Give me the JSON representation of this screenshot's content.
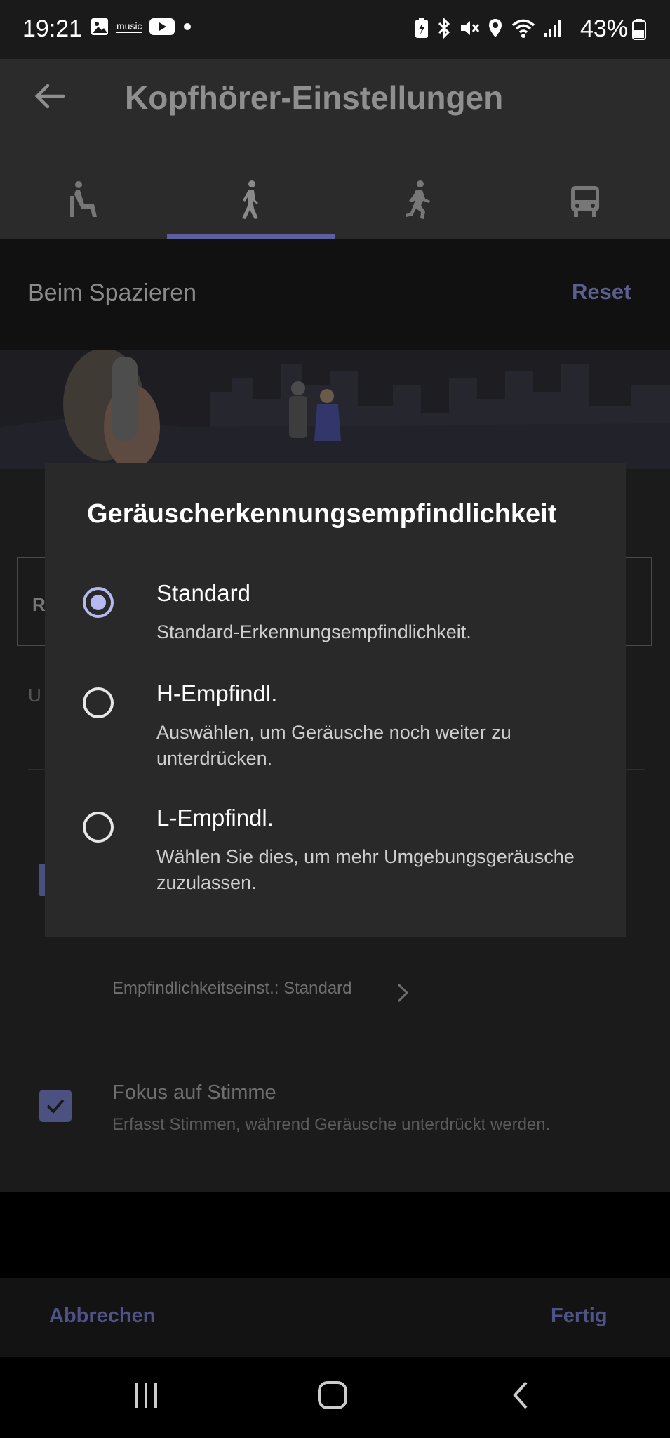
{
  "status_bar": {
    "time": "19:21",
    "app_icons": [
      "gallery-icon",
      "amazon-music-icon",
      "youtube-icon",
      "dot-icon"
    ],
    "system_icons": [
      "battery-saver-icon",
      "bluetooth-icon",
      "mute-icon",
      "location-icon",
      "wifi-icon",
      "signal-icon"
    ],
    "music_label": "music",
    "battery": "43%"
  },
  "app_bar": {
    "title": "Kopfhörer-Einstellungen"
  },
  "tabs": [
    {
      "name": "sitting-icon"
    },
    {
      "name": "walking-icon"
    },
    {
      "name": "running-icon"
    },
    {
      "name": "train-icon"
    }
  ],
  "section": {
    "title": "Beim Spazieren",
    "reset": "Reset"
  },
  "background": {
    "card_letter": "R",
    "u_letter": "U",
    "sensitivity_setting": "Empfindlichkeitseinst.: Standard",
    "voice_focus_title": "Fokus auf Stimme",
    "voice_focus_desc": "Erfasst Stimmen, während Geräusche unterdrückt werden.",
    "voice_focus_checked": true
  },
  "dialog": {
    "title": "Geräuscherkennungsempfindlichkeit",
    "options": [
      {
        "title": "Standard",
        "desc": "Standard-Erkennungsempfindlichkeit.",
        "selected": true
      },
      {
        "title": "H-Empfindl.",
        "desc": "Auswählen, um Geräusche noch weiter zu unterdrücken.",
        "selected": false
      },
      {
        "title": "L-Empfindl.",
        "desc": "Wählen Sie dies, um mehr Umgebungsgeräusche zuzulassen.",
        "selected": false
      }
    ]
  },
  "bottom_buttons": {
    "cancel": "Abbrechen",
    "done": "Fertig"
  },
  "colors": {
    "accent": "#b6b9f0",
    "dim_accent": "#4e5286"
  }
}
